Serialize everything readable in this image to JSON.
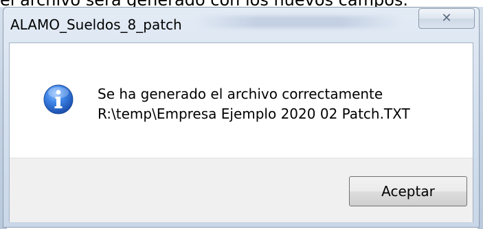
{
  "background": {
    "text": "el archivo será generado con los nuevos campos."
  },
  "dialog": {
    "title": "ALAMO_Sueldos_8_patch",
    "close_symbol": "✕",
    "icon": "information-icon",
    "message_line1": "Se ha generado el archivo correctamente",
    "message_line2": "R:\\temp\\Empresa Ejemplo 2020 02 Patch.TXT",
    "ok_label": "Aceptar"
  },
  "colors": {
    "icon_blue": "#2f6fd1",
    "frame": "#d4e0ee"
  }
}
